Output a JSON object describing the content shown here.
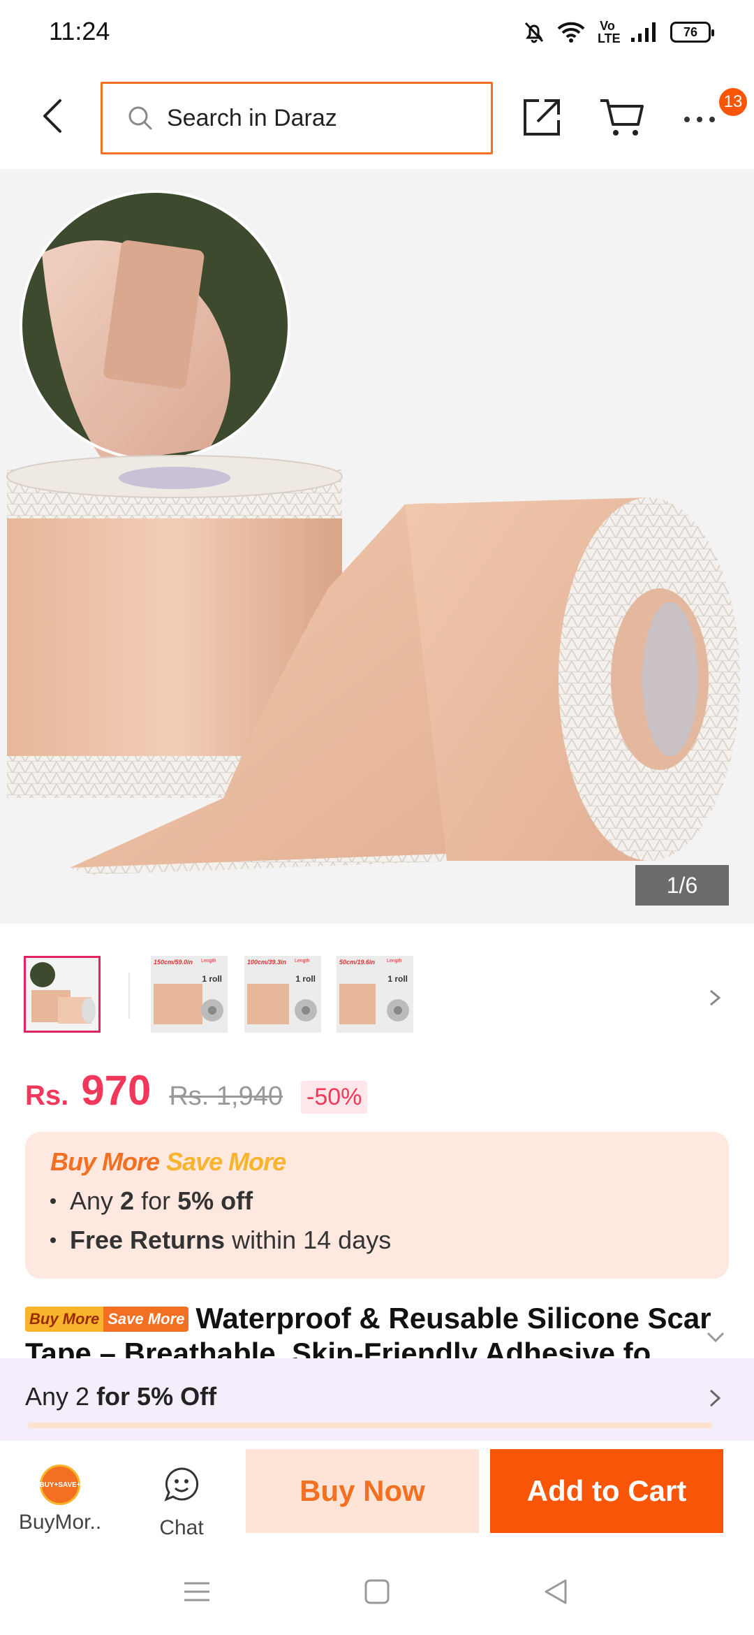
{
  "status_bar": {
    "time": "11:24",
    "battery": "76",
    "network_label": "Vo LTE",
    "icons": [
      "mute-bell-icon",
      "wifi-icon",
      "volte-icon",
      "signal-icon",
      "battery-icon"
    ]
  },
  "header": {
    "search_placeholder": "Search in Daraz",
    "cart_badge": "13",
    "icons": [
      "back-arrow-icon",
      "search-icon",
      "share-icon",
      "cart-icon",
      "more-icon"
    ]
  },
  "gallery": {
    "counter": "1/6",
    "thumbnails": [
      {
        "label": "",
        "length": "",
        "roll": ""
      },
      {
        "label": "150cm/59.0in",
        "length": "Length",
        "roll": "1 roll"
      },
      {
        "label": "100cm/39.3in",
        "length": "Length",
        "roll": "1 roll"
      },
      {
        "label": "50cm/19.6in",
        "length": "Length",
        "roll": "1 roll"
      }
    ]
  },
  "price": {
    "currency": "Rs.",
    "current": "970",
    "original": "Rs. 1,940",
    "discount": "-50%"
  },
  "promo": {
    "title_part1": "Buy More",
    "title_part2": "Save More",
    "line1_pre": "Any ",
    "line1_qty": "2",
    "line1_mid": " for ",
    "line1_off": "5% off",
    "line2_bold": "Free Returns",
    "line2_rest": " within 14 days"
  },
  "product": {
    "tag_part1": "Buy More",
    "tag_part2": "Save More",
    "title": "Waterproof & Reusable Silicone Scar Tape – Breathable, Skin-Friendly Adhesive fo"
  },
  "bundle": {
    "text_pre": "Any 2 ",
    "text_bold": "for 5% Off"
  },
  "actions": {
    "buymore_label": "BuyMor..",
    "buymore_badge_top": "BUY+",
    "buymore_badge_bottom": "SAVE+",
    "chat_label": "Chat",
    "buy_now": "Buy Now",
    "add_to_cart": "Add to Cart"
  },
  "colors": {
    "accent": "#f85606",
    "search_border": "#f36f21",
    "price": "#f2385a",
    "promo_bg": "#fee8df",
    "bundle_bg": "#f4edfb"
  }
}
